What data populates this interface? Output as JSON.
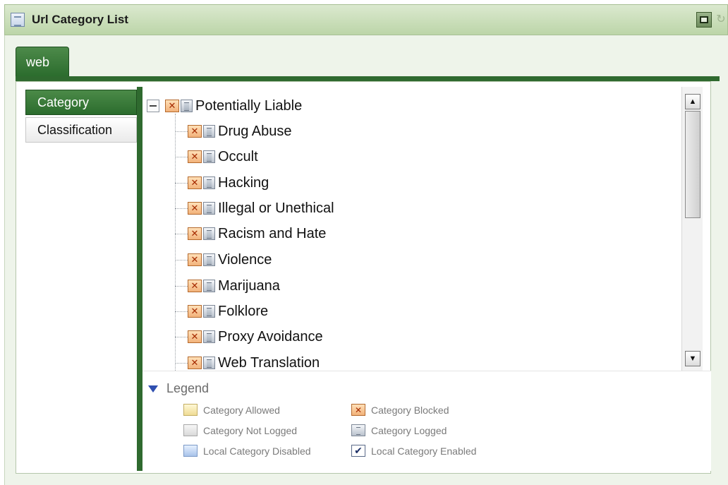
{
  "window": {
    "title": "Url Category List"
  },
  "tabs": [
    {
      "label": "web",
      "active": true
    }
  ],
  "sidebar": {
    "items": [
      {
        "label": "Category",
        "active": true
      },
      {
        "label": "Classification",
        "active": false
      }
    ]
  },
  "tree": {
    "root": {
      "label": "Potentially Liable",
      "expanded": true,
      "status": "blocked",
      "logged": true
    },
    "children": [
      {
        "label": "Drug Abuse",
        "status": "blocked",
        "logged": true
      },
      {
        "label": "Occult",
        "status": "blocked",
        "logged": true
      },
      {
        "label": "Hacking",
        "status": "blocked",
        "logged": true
      },
      {
        "label": "Illegal or Unethical",
        "status": "blocked",
        "logged": true
      },
      {
        "label": "Racism and Hate",
        "status": "blocked",
        "logged": true
      },
      {
        "label": "Violence",
        "status": "blocked",
        "logged": true
      },
      {
        "label": "Marijuana",
        "status": "blocked",
        "logged": true
      },
      {
        "label": "Folklore",
        "status": "blocked",
        "logged": true
      },
      {
        "label": "Proxy Avoidance",
        "status": "blocked",
        "logged": true
      },
      {
        "label": "Web Translation",
        "status": "blocked",
        "logged": true
      }
    ]
  },
  "legend": {
    "title": "Legend",
    "entries": [
      {
        "label": "Category Allowed",
        "icon": "category-allowed-icon"
      },
      {
        "label": "Category Blocked",
        "icon": "category-blocked-icon"
      },
      {
        "label": "Category Not Logged",
        "icon": "category-not-logged-icon"
      },
      {
        "label": "Category Logged",
        "icon": "category-logged-icon"
      },
      {
        "label": "Local Category Disabled",
        "icon": "local-category-disabled-icon"
      },
      {
        "label": "Local Category Enabled",
        "icon": "local-category-enabled-icon"
      }
    ]
  },
  "glyphs": {
    "blocked": "✕",
    "check": "✔",
    "arrow_up": "▲",
    "arrow_down": "▼",
    "refresh": "↻"
  },
  "colors": {
    "accent_green": "#2f6a2f",
    "titlebar_green": "#c9dcb9",
    "blocked_orange": "#f2b27a"
  }
}
